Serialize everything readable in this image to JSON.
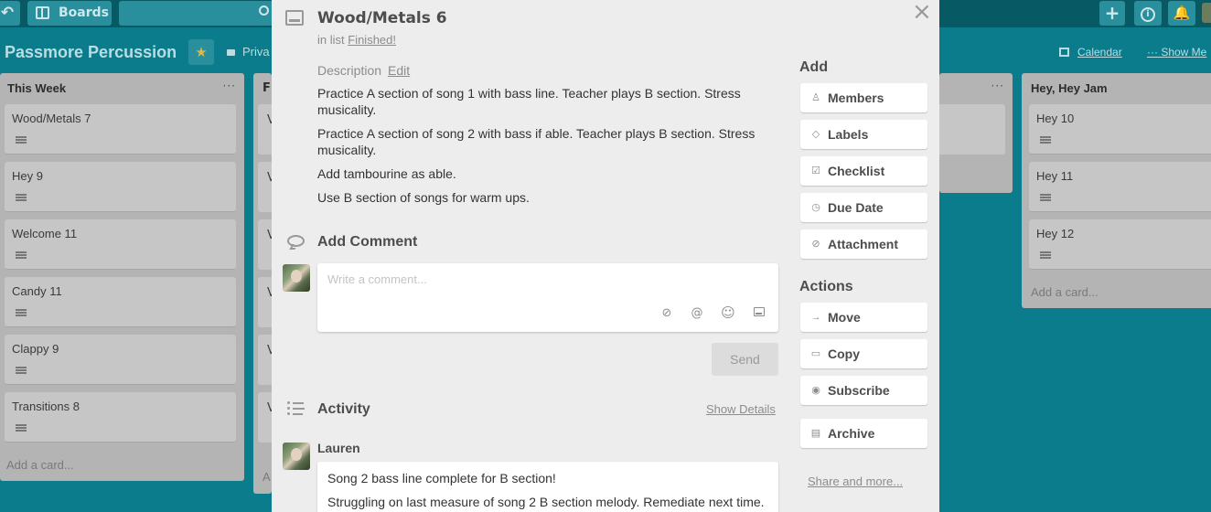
{
  "topbar": {
    "back_glyph": "↶",
    "boards_label": "Boards",
    "add_glyph": "+",
    "info_glyph": "i",
    "bell_glyph": "🔔"
  },
  "board": {
    "title": "Passmore Percussion",
    "star_glyph": "★",
    "visibility": "Priva",
    "calendar_label": "Calendar",
    "show_menu_label": "··· Show Me"
  },
  "lists": {
    "this_week": {
      "title": "This Week",
      "menu_glyph": "···",
      "cards": [
        "Wood/Metals 7",
        "Hey 9",
        "Welcome 11",
        "Candy 11",
        "Clappy 9",
        "Transitions 8"
      ],
      "add_card": "Add a card..."
    },
    "second": {
      "title_partial": "F",
      "stub_letters": [
        "V",
        "V",
        "V",
        "V",
        "V",
        "V"
      ],
      "add_partial": "A"
    },
    "third": {
      "menu_glyph": "···"
    },
    "hey_hey_jam": {
      "title": "Hey, Hey Jam",
      "cards": [
        "Hey 10",
        "Hey 11",
        "Hey 12"
      ],
      "add_card": "Add a card..."
    }
  },
  "modal": {
    "title": "Wood/Metals 6",
    "in_list_prefix": "in list",
    "list_name": "Finished!",
    "close_glyph": "×",
    "description_label": "Description",
    "description_edit": "Edit",
    "description": [
      "Practice A section of song 1 with bass line. Teacher plays B section. Stress musicality.",
      "Practice A section of song 2 with bass if able. Teacher plays B section. Stress musicality.",
      "Add tambourine as able.",
      "Use B section of songs for warm ups."
    ],
    "add_comment_title": "Add Comment",
    "comment_placeholder": "Write a comment...",
    "comment_tools": {
      "attach": "⊘",
      "mention": "@",
      "emoji": "☺"
    },
    "send_label": "Send",
    "activity_title": "Activity",
    "show_details": "Show Details",
    "activity": {
      "user": "Lauren",
      "lines": [
        "Song 2 bass line complete for B section!",
        "Struggling on last measure of song 2 B section melody. Remediate next time."
      ]
    }
  },
  "sidebar": {
    "add_title": "Add",
    "add_buttons": [
      {
        "label": "Members",
        "icon": "♙"
      },
      {
        "label": "Labels",
        "icon": "◇"
      },
      {
        "label": "Checklist",
        "icon": "☑"
      },
      {
        "label": "Due Date",
        "icon": "◷"
      },
      {
        "label": "Attachment",
        "icon": "⊘"
      }
    ],
    "actions_title": "Actions",
    "action_buttons": [
      {
        "label": "Move",
        "icon": "→"
      },
      {
        "label": "Copy",
        "icon": "▭"
      },
      {
        "label": "Subscribe",
        "icon": "◉"
      },
      {
        "label": "Archive",
        "icon": "▤"
      }
    ],
    "share_label": "Share and more..."
  },
  "colors": {
    "background": "#0a7c8b",
    "modal": "#ededed",
    "star": "#d9b949"
  }
}
